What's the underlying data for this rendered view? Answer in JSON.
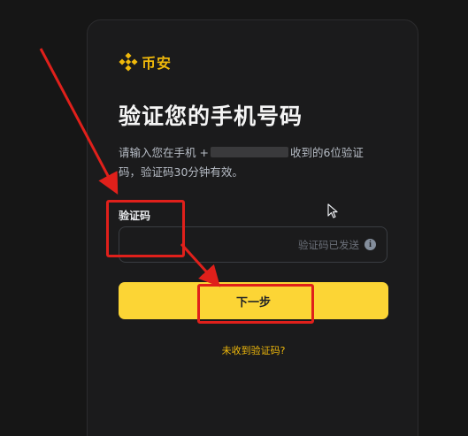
{
  "brand": {
    "name": "币安",
    "color": "#f0b90b",
    "logo_icon": "binance-logo-icon"
  },
  "page": {
    "title": "验证您的手机号码",
    "description_part1": "请输入您在手机 +",
    "description_part2": "收到的6位验证码，验证码30分钟有效。"
  },
  "form": {
    "code_label": "验证码",
    "code_value": "",
    "status_text": "验证码已发送",
    "status_icon": "info-icon"
  },
  "actions": {
    "next_label": "下一步",
    "resend_label": "未收到验证码?"
  },
  "colors": {
    "background": "#161616",
    "card": "#1b1b1c",
    "accent": "#fcd535",
    "annotation": "#e0201b"
  }
}
